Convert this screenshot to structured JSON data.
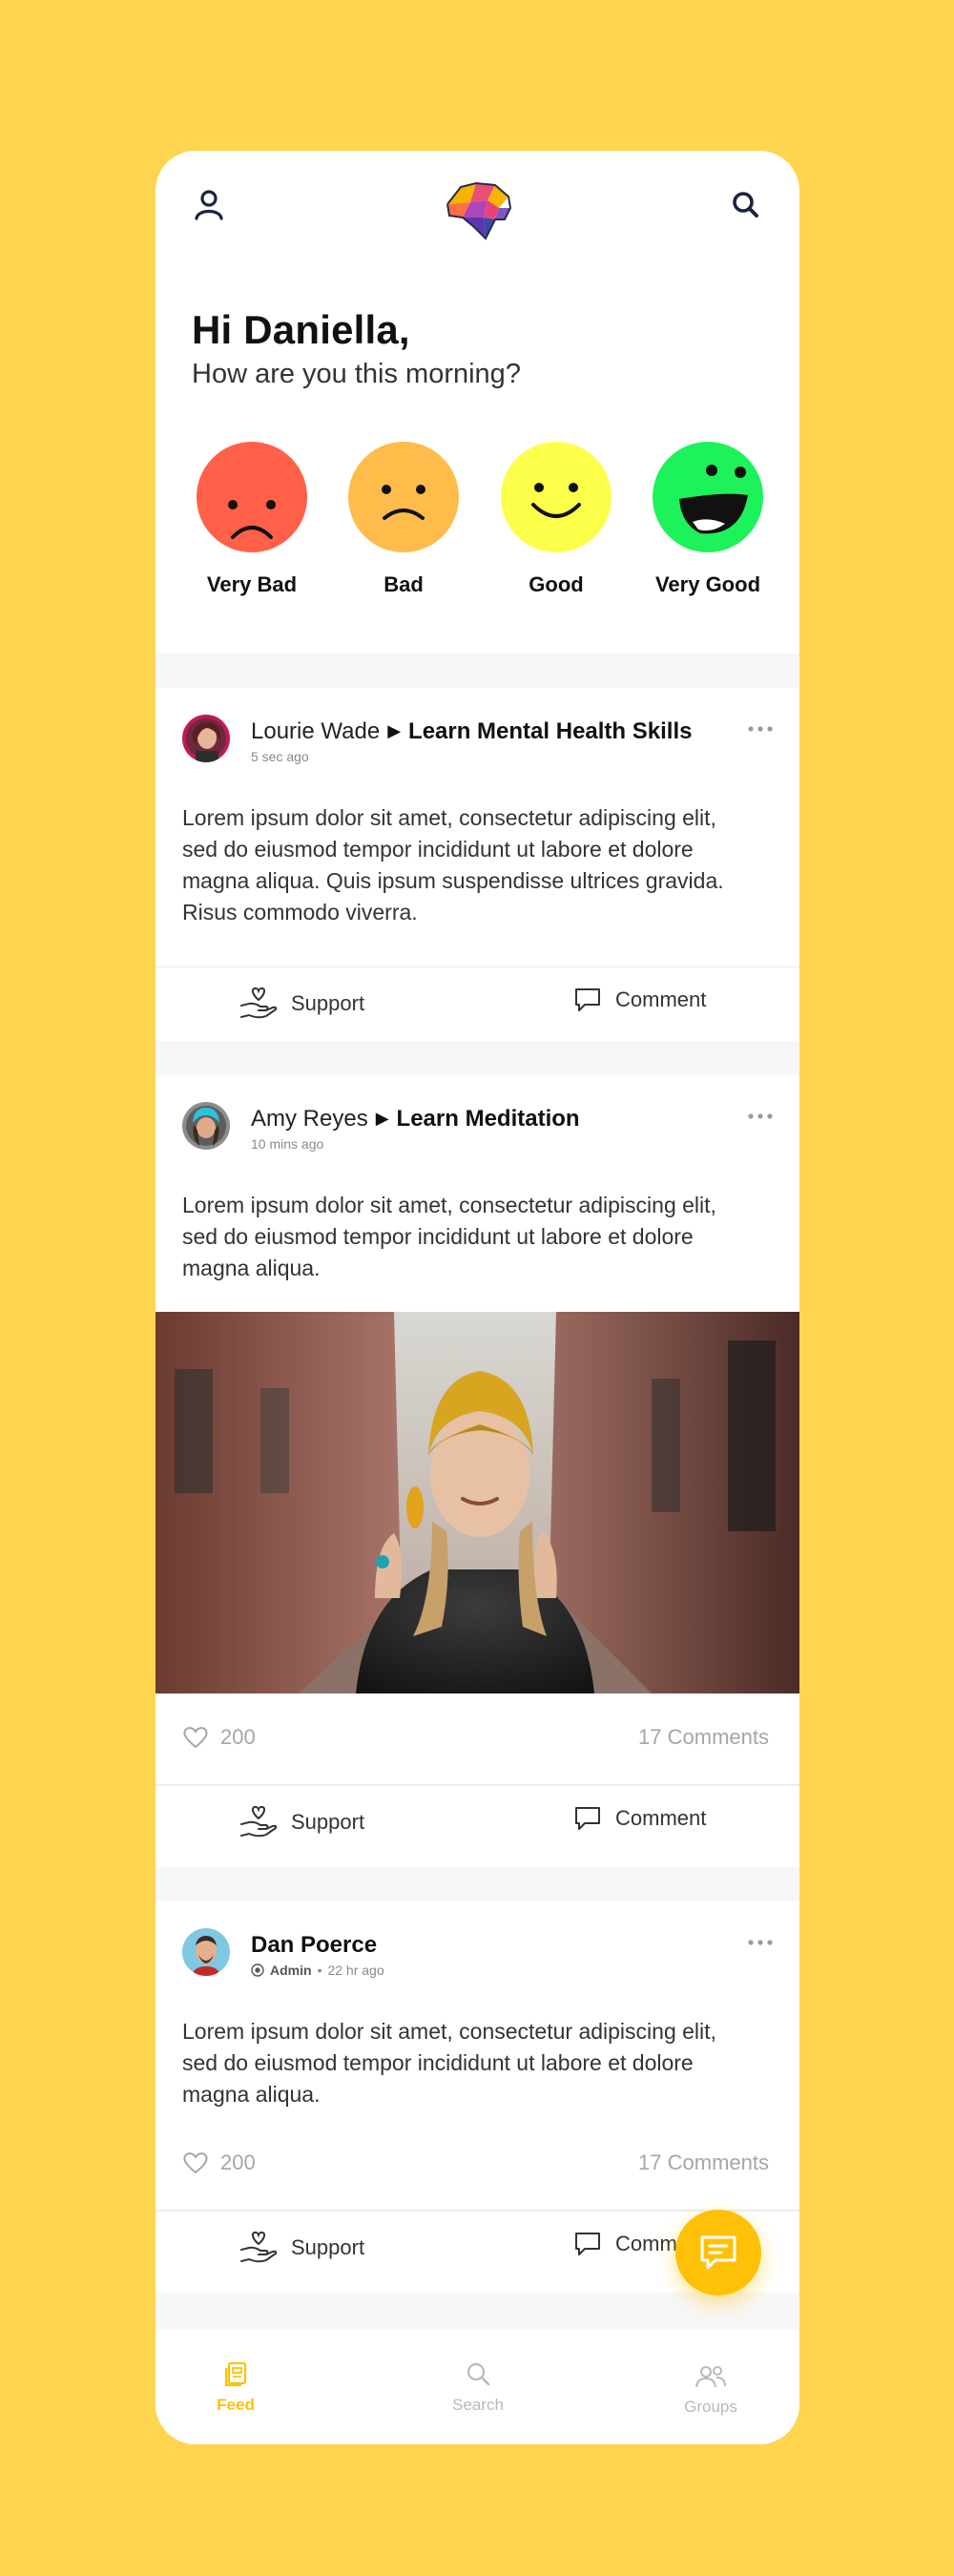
{
  "colors": {
    "background": "#FFD54F",
    "accent": "#FFC107",
    "very_bad": "#FF6047",
    "bad": "#FFBC4A",
    "good": "#FCFF4A",
    "very_good": "#1EF25A"
  },
  "header": {
    "profile_icon": "user-icon",
    "logo": "brain-logo",
    "search_icon": "search-icon"
  },
  "greeting": {
    "title": "Hi Daniella,",
    "subtitle": "How are you this morning?"
  },
  "moods": [
    {
      "label": "Very Bad",
      "icon": "very-bad-face-icon"
    },
    {
      "label": "Bad",
      "icon": "bad-face-icon"
    },
    {
      "label": "Good",
      "icon": "good-face-icon"
    },
    {
      "label": "Very Good",
      "icon": "very-good-face-icon"
    }
  ],
  "posts": [
    {
      "author": "Lourie Wade",
      "topic": "Learn Mental Health Skills",
      "time": "5 sec ago",
      "text": "Lorem ipsum dolor sit amet, consectetur adipiscing elit, sed do eiusmod tempor incididunt ut labore et dolore magna aliqua. Quis ipsum suspendisse ultrices gravida. Risus commodo viverra.",
      "support_label": "Support",
      "comment_label": "Comment"
    },
    {
      "author": "Amy Reyes",
      "topic": "Learn Meditation",
      "time": "10 mins ago",
      "text": "Lorem ipsum dolor sit amet, consectetur adipiscing elit, sed do eiusmod tempor incididunt ut labore et dolore magna aliqua.",
      "likes": "200",
      "comments": "17 Comments",
      "support_label": "Support",
      "comment_label": "Comment"
    },
    {
      "author": "Dan Poerce",
      "role": "Admin",
      "separator": "•",
      "time": "22 hr ago",
      "text": "Lorem ipsum dolor sit amet, consectetur adipiscing elit, sed do eiusmod tempor incididunt ut labore et dolore magna aliqua.",
      "likes": "200",
      "comments": "17 Comments",
      "support_label": "Support",
      "comment_label": "Comment"
    }
  ],
  "nav": {
    "feed": "Feed",
    "search": "Search",
    "groups": "Groups"
  }
}
